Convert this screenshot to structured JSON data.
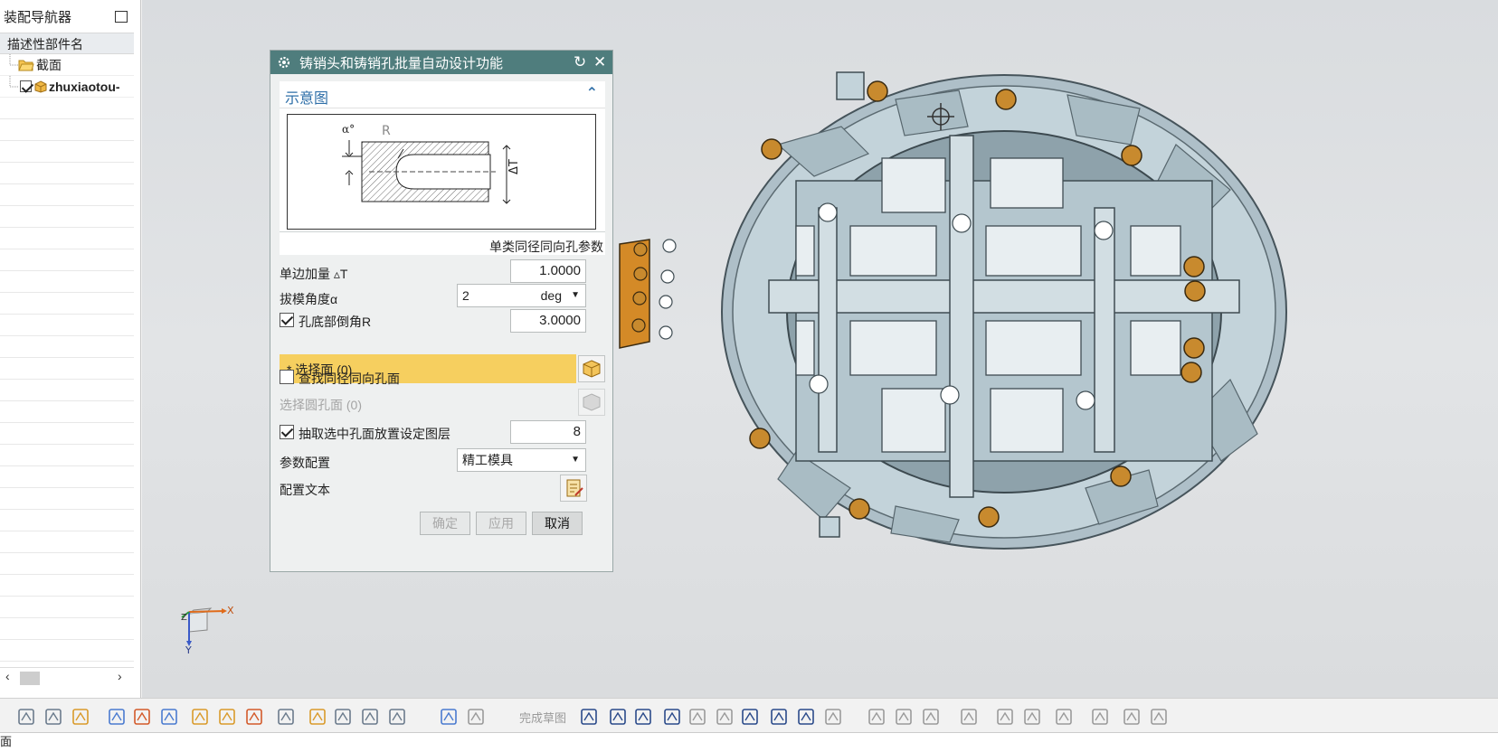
{
  "navigator": {
    "title": "装配导航器",
    "column_header": "描述性部件名",
    "tree": [
      {
        "label": "截面"
      },
      {
        "label": "zhuxiaotou-"
      }
    ]
  },
  "dialog": {
    "title": "铸销头和铸销孔批量自动设计功能",
    "section_title": "示意图",
    "schematic": {
      "alpha": "α°",
      "r": "R",
      "delta_t": "ΔT"
    },
    "group_label": "单类同径同向孔参数",
    "single_side_label": "单边加量 ▵T",
    "single_side_value": "1.0000",
    "draft_label": "拔模角度α",
    "draft_value": "2",
    "draft_unit": "deg",
    "chamfer_label": "孔底部倒角R",
    "chamfer_value": "3.0000",
    "chamfer_checked": true,
    "select_face_label": "* 选择面 (0)",
    "find_same_label": "查找同径同向孔面",
    "find_same_checked": false,
    "select_hole_label": "选择圆孔面 (0)",
    "extract_label": "抽取选中孔面放置设定图层",
    "extract_checked": true,
    "layer_value": "8",
    "param_config_label": "参数配置",
    "param_config_value": "精工模具",
    "config_text_label": "配置文本",
    "ok_label": "确定",
    "apply_label": "应用",
    "cancel_label": "取消"
  },
  "triad": {
    "x": "X",
    "y": "Y",
    "z": "Z"
  },
  "toolbar": {
    "finish_sketch": "完成草图"
  },
  "status": {
    "text": "面"
  },
  "colors": {
    "titlebar": "#4f7d7d",
    "highlight": "#f6cf5f",
    "part": "#b9cdd6",
    "hole": "#c88a2e",
    "link": "#2f6fa8"
  }
}
